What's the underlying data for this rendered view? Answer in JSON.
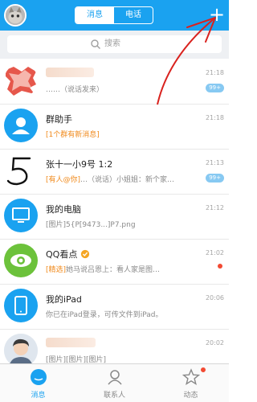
{
  "header": {
    "tabs": [
      "消息",
      "电话"
    ],
    "active_tab": 0,
    "plus_label": "+"
  },
  "search": {
    "placeholder": "搜索"
  },
  "chats": [
    {
      "name": "",
      "message": "……（说话发来）",
      "time": "21:18",
      "badge": "99+",
      "avatar": "hidden-avatar",
      "blurred": true
    },
    {
      "name": "群助手",
      "tag": "[1个群有新消息]",
      "message": "",
      "time": "21:18",
      "avatar": "group-helper-icon"
    },
    {
      "name": "张十一小9号 1:2",
      "tag": "[有人@你]",
      "message": "…（说话）小姐姐：新个家…",
      "time": "21:13",
      "badge": "99+",
      "avatar": "handwritten-5-avatar"
    },
    {
      "name": "我的电脑",
      "tag": "",
      "message": "[图片]5{P[9473...]P7.png",
      "time": "21:12",
      "avatar": "computer-icon"
    },
    {
      "name": "QQ看点",
      "tag": "[精选]",
      "message": "她马说吕恩上：看人家是图…",
      "time": "21:02",
      "dot": true,
      "avatar": "qq-kandian-icon",
      "verified": true
    },
    {
      "name": "我的iPad",
      "tag": "",
      "message": "你已在iPad登录，可传文件到iPad。",
      "time": "20:06",
      "avatar": "ipad-icon"
    },
    {
      "name": "",
      "tag": "",
      "message": "[图片][图片][图片]",
      "time": "20:02",
      "avatar": "boy-avatar",
      "blurred_name": true
    }
  ],
  "tabbar": {
    "items": [
      {
        "label": "消息",
        "icon": "message-icon",
        "active": true
      },
      {
        "label": "联系人",
        "icon": "contacts-icon",
        "active": false
      },
      {
        "label": "动态",
        "icon": "star-icon",
        "active": false,
        "dot": true
      }
    ]
  },
  "colors": {
    "accent": "#1aa2f0",
    "tag": "#f08a1c",
    "badge": "#87c9f2",
    "dot": "#f24a33",
    "annotation": "#d9221e"
  }
}
